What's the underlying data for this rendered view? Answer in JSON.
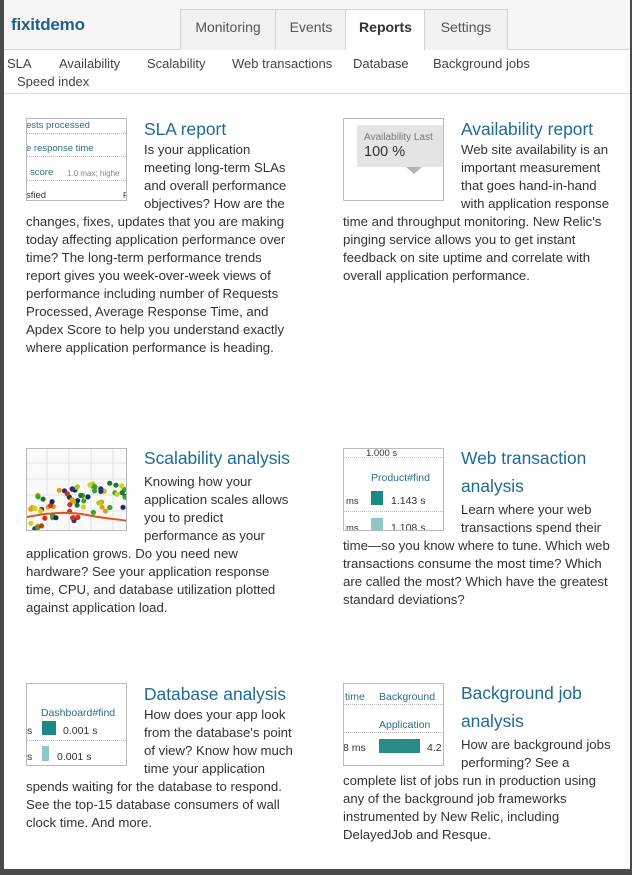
{
  "app": {
    "name": "fixitdemo"
  },
  "tabs": [
    {
      "label": "Monitoring",
      "active": false
    },
    {
      "label": "Events",
      "active": false
    },
    {
      "label": "Reports",
      "active": true
    },
    {
      "label": "Settings",
      "active": false
    }
  ],
  "subnav": [
    {
      "label": "SLA"
    },
    {
      "label": "Availability"
    },
    {
      "label": "Scalability"
    },
    {
      "label": "Web transactions"
    },
    {
      "label": "Database"
    },
    {
      "label": "Background jobs"
    },
    {
      "label": "Speed index"
    }
  ],
  "reports": [
    {
      "title": "SLA report",
      "description": "Is your application meeting long-term SLAs and overall performance objectives? How are the changes, fixes, updates that you are making today affecting application performance over time? The long-term performance trends report gives you week-over-week views of performance including number of Requests Processed, Average Response Time, and Apdex Score to help you understand exactly where application performance is heading.",
      "thumb": {
        "row1": "ests processed",
        "row2": "e response time",
        "row3": "score",
        "row3b": "1.0 max; highe",
        "row4": "sfied",
        "row4b": "F"
      }
    },
    {
      "title": "Availability report",
      "description": "Web site availability is an important measurement that goes hand-in-hand with application response time and throughput monitoring. New Relic's pinging service allows you to get instant feedback on site uptime and correlate with overall application performance.",
      "thumb": {
        "label": "Availability Last",
        "value": "100 %"
      }
    },
    {
      "title": "Scalability analysis",
      "description": "Knowing how your application scales allows you to predict performance as your application grows. Do you need new hardware? See your application response time, CPU, and database utilization plotted against application load."
    },
    {
      "title": "Web transaction analysis",
      "description": "Learn where your web transactions spend their time—so you know where to tune. Which web transactions consume the most time? Which are called the most? Which have the greatest standard deviations?",
      "thumb": {
        "top": "1.000 s",
        "name": "Product#find",
        "ms1": "ms",
        "v1": "1.143 s",
        "ms2": "ms",
        "v2": "1.108 s"
      }
    },
    {
      "title": "Database analysis",
      "description": "How does your app look from the database's point of view? Know how much time your application spends waiting for the database to respond. See the top-15 database consumers of wall clock time. And more.",
      "thumb": {
        "name": "Dashboard#find",
        "s1": "s",
        "v1": "0.001 s",
        "s2": "s",
        "v2": "0.001 s"
      }
    },
    {
      "title": "Background job analysis",
      "description": "How are background jobs performing? See a complete list of jobs run in production using any of the background job frameworks instrumented by New Relic, including DelayedJob and Resque.",
      "thumb": {
        "col1": "time",
        "col2": "Background",
        "name": "Application",
        "ms": "8 ms",
        "v": "4.2"
      }
    }
  ]
}
